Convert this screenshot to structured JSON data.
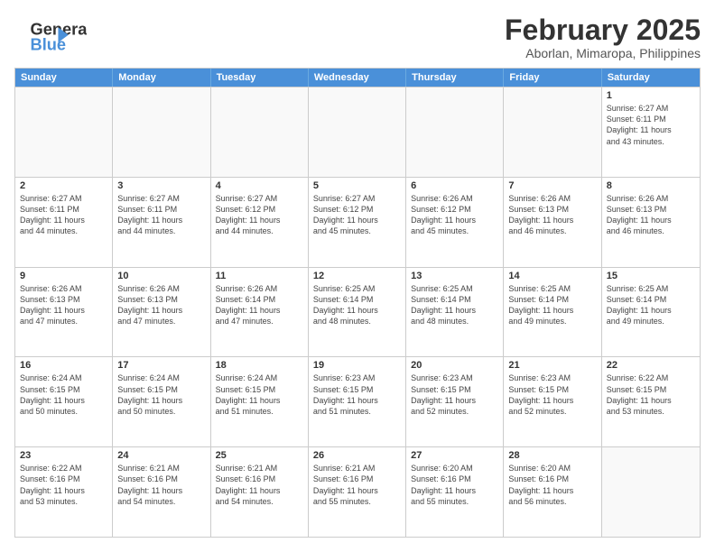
{
  "header": {
    "logo_line1": "General",
    "logo_line2": "Blue",
    "month": "February 2025",
    "location": "Aborlan, Mimaropa, Philippines"
  },
  "days": [
    "Sunday",
    "Monday",
    "Tuesday",
    "Wednesday",
    "Thursday",
    "Friday",
    "Saturday"
  ],
  "rows": [
    [
      {
        "day": "",
        "empty": true
      },
      {
        "day": "",
        "empty": true
      },
      {
        "day": "",
        "empty": true
      },
      {
        "day": "",
        "empty": true
      },
      {
        "day": "",
        "empty": true
      },
      {
        "day": "",
        "empty": true
      },
      {
        "day": "1",
        "text": "Sunrise: 6:27 AM\nSunset: 6:11 PM\nDaylight: 11 hours\nand 43 minutes."
      }
    ],
    [
      {
        "day": "2",
        "text": "Sunrise: 6:27 AM\nSunset: 6:11 PM\nDaylight: 11 hours\nand 44 minutes."
      },
      {
        "day": "3",
        "text": "Sunrise: 6:27 AM\nSunset: 6:11 PM\nDaylight: 11 hours\nand 44 minutes."
      },
      {
        "day": "4",
        "text": "Sunrise: 6:27 AM\nSunset: 6:12 PM\nDaylight: 11 hours\nand 44 minutes."
      },
      {
        "day": "5",
        "text": "Sunrise: 6:27 AM\nSunset: 6:12 PM\nDaylight: 11 hours\nand 45 minutes."
      },
      {
        "day": "6",
        "text": "Sunrise: 6:26 AM\nSunset: 6:12 PM\nDaylight: 11 hours\nand 45 minutes."
      },
      {
        "day": "7",
        "text": "Sunrise: 6:26 AM\nSunset: 6:13 PM\nDaylight: 11 hours\nand 46 minutes."
      },
      {
        "day": "8",
        "text": "Sunrise: 6:26 AM\nSunset: 6:13 PM\nDaylight: 11 hours\nand 46 minutes."
      }
    ],
    [
      {
        "day": "9",
        "text": "Sunrise: 6:26 AM\nSunset: 6:13 PM\nDaylight: 11 hours\nand 47 minutes."
      },
      {
        "day": "10",
        "text": "Sunrise: 6:26 AM\nSunset: 6:13 PM\nDaylight: 11 hours\nand 47 minutes."
      },
      {
        "day": "11",
        "text": "Sunrise: 6:26 AM\nSunset: 6:14 PM\nDaylight: 11 hours\nand 47 minutes."
      },
      {
        "day": "12",
        "text": "Sunrise: 6:25 AM\nSunset: 6:14 PM\nDaylight: 11 hours\nand 48 minutes."
      },
      {
        "day": "13",
        "text": "Sunrise: 6:25 AM\nSunset: 6:14 PM\nDaylight: 11 hours\nand 48 minutes."
      },
      {
        "day": "14",
        "text": "Sunrise: 6:25 AM\nSunset: 6:14 PM\nDaylight: 11 hours\nand 49 minutes."
      },
      {
        "day": "15",
        "text": "Sunrise: 6:25 AM\nSunset: 6:14 PM\nDaylight: 11 hours\nand 49 minutes."
      }
    ],
    [
      {
        "day": "16",
        "text": "Sunrise: 6:24 AM\nSunset: 6:15 PM\nDaylight: 11 hours\nand 50 minutes."
      },
      {
        "day": "17",
        "text": "Sunrise: 6:24 AM\nSunset: 6:15 PM\nDaylight: 11 hours\nand 50 minutes."
      },
      {
        "day": "18",
        "text": "Sunrise: 6:24 AM\nSunset: 6:15 PM\nDaylight: 11 hours\nand 51 minutes."
      },
      {
        "day": "19",
        "text": "Sunrise: 6:23 AM\nSunset: 6:15 PM\nDaylight: 11 hours\nand 51 minutes."
      },
      {
        "day": "20",
        "text": "Sunrise: 6:23 AM\nSunset: 6:15 PM\nDaylight: 11 hours\nand 52 minutes."
      },
      {
        "day": "21",
        "text": "Sunrise: 6:23 AM\nSunset: 6:15 PM\nDaylight: 11 hours\nand 52 minutes."
      },
      {
        "day": "22",
        "text": "Sunrise: 6:22 AM\nSunset: 6:15 PM\nDaylight: 11 hours\nand 53 minutes."
      }
    ],
    [
      {
        "day": "23",
        "text": "Sunrise: 6:22 AM\nSunset: 6:16 PM\nDaylight: 11 hours\nand 53 minutes."
      },
      {
        "day": "24",
        "text": "Sunrise: 6:21 AM\nSunset: 6:16 PM\nDaylight: 11 hours\nand 54 minutes."
      },
      {
        "day": "25",
        "text": "Sunrise: 6:21 AM\nSunset: 6:16 PM\nDaylight: 11 hours\nand 54 minutes."
      },
      {
        "day": "26",
        "text": "Sunrise: 6:21 AM\nSunset: 6:16 PM\nDaylight: 11 hours\nand 55 minutes."
      },
      {
        "day": "27",
        "text": "Sunrise: 6:20 AM\nSunset: 6:16 PM\nDaylight: 11 hours\nand 55 minutes."
      },
      {
        "day": "28",
        "text": "Sunrise: 6:20 AM\nSunset: 6:16 PM\nDaylight: 11 hours\nand 56 minutes."
      },
      {
        "day": "",
        "empty": true
      }
    ]
  ]
}
